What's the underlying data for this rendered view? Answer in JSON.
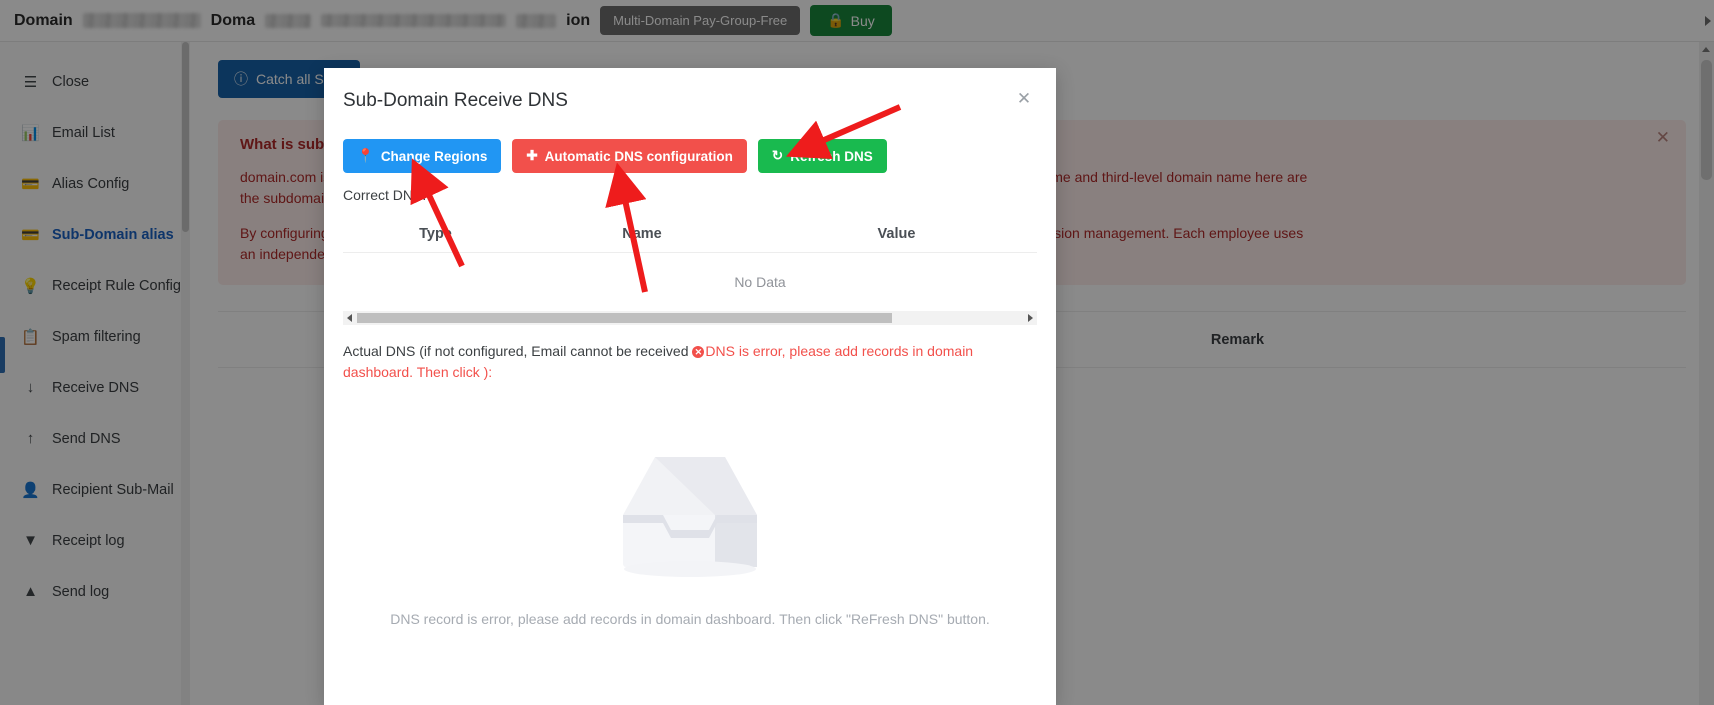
{
  "topbar": {
    "domain_label": "Domain",
    "domain_label_2": "Doma",
    "ion_fragment": "ion",
    "plan_pill": "Multi-Domain Pay-Group-Free",
    "buy_label": "Buy",
    "lock_icon": "lock-icon"
  },
  "sidebar": {
    "items": [
      {
        "label": "Close",
        "icon": "collapse-menu-icon",
        "active": false
      },
      {
        "label": "Email List",
        "icon": "bar-chart-icon",
        "active": false
      },
      {
        "label": "Alias Config",
        "icon": "wallet-icon",
        "active": false
      },
      {
        "label": "Sub-Domain alias",
        "icon": "wallet-icon",
        "active": true
      },
      {
        "label": "Receipt Rule Config",
        "icon": "bulb-icon",
        "active": false
      },
      {
        "label": "Spam filtering",
        "icon": "clipboard-x-icon",
        "active": false
      },
      {
        "label": "Receive DNS",
        "icon": "arrow-down-icon",
        "active": false
      },
      {
        "label": "Send DNS",
        "icon": "arrow-up-icon",
        "active": false
      },
      {
        "label": "Recipient Sub-Mail",
        "icon": "user-icon",
        "active": false
      },
      {
        "label": "Receipt log",
        "icon": "caret-down-icon",
        "active": false
      },
      {
        "label": "Send log",
        "icon": "caret-up-icon",
        "active": false
      }
    ]
  },
  "main": {
    "catch_all_button": "Catch all Sub-",
    "alert": {
      "title": "What is subdo",
      "line1_left": "domain.com is",
      "line1_left_2": "the subdomain",
      "line1_right": "in name. The second-level domain name and third-level domain name here are",
      "line2_left": "By configuring",
      "line2_left_2": "an independen",
      "line2_right": "s very convenient for employee permission management. Each employee uses",
      "close_icon": "close-icon"
    },
    "table_headers": [
      "Remark"
    ]
  },
  "modal": {
    "title": "Sub-Domain Receive DNS",
    "close_icon": "close-icon",
    "buttons": [
      {
        "label": "Change Regions",
        "icon": "location-pin-icon",
        "color": "#2196f3"
      },
      {
        "label": "Automatic DNS configuration",
        "icon": "plus-circle-icon",
        "color": "#f2504b"
      },
      {
        "label": "Refresh DNS",
        "icon": "refresh-icon",
        "color": "#19ba4f"
      }
    ],
    "correct_dns_label": "Correct DNS:",
    "table": {
      "headers": [
        "Type",
        "Name",
        "Value"
      ],
      "rows": [],
      "empty_text": "No Data"
    },
    "actual_dns_prefix": "Actual DNS (if not configured, Email cannot be received ",
    "actual_dns_error": "DNS is error, please add records in domain dashboard. Then click ):",
    "error_badge_icon": "error-circle-icon",
    "empty_illustration": "empty-box-illustration",
    "empty_caption": "DNS record is error, please add records in domain dashboard. Then click \"ReFresh DNS\" button."
  },
  "annotations": {
    "arrows": [
      {
        "name": "arrow-to-refresh-dns"
      },
      {
        "name": "arrow-to-change-regions"
      },
      {
        "name": "arrow-to-automatic-dns"
      }
    ],
    "color": "#ee1c1c"
  }
}
